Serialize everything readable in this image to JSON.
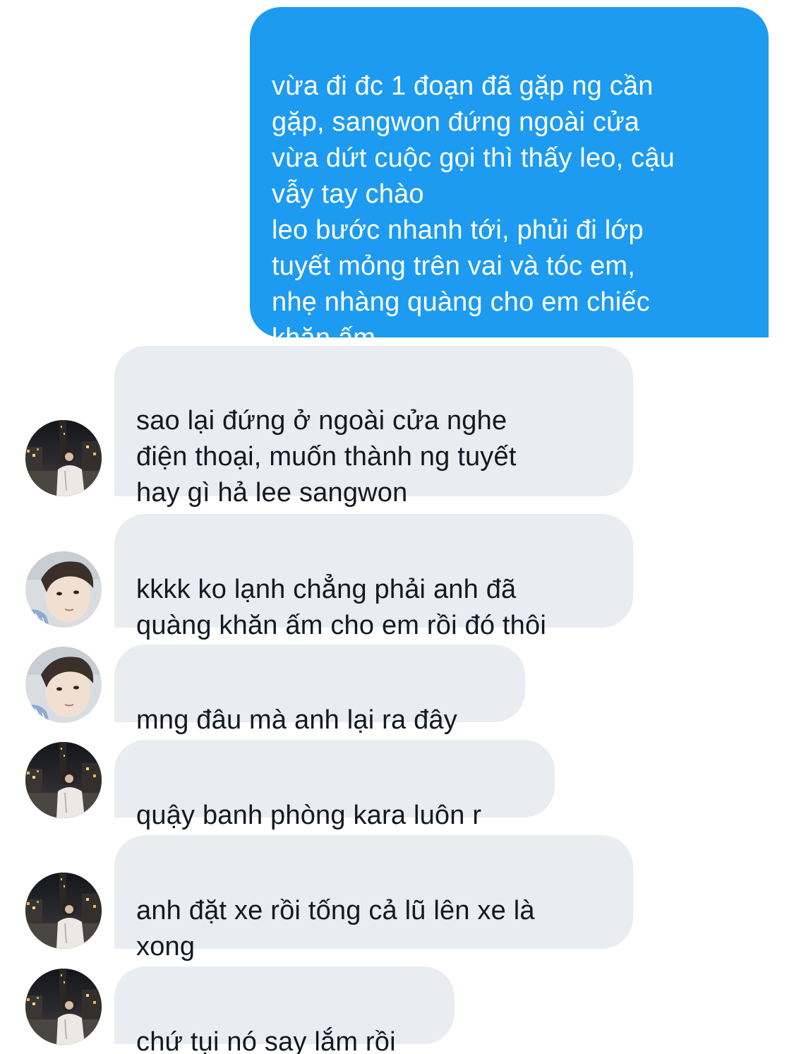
{
  "conversation": {
    "messages": [
      {
        "direction": "sent",
        "text": "vừa đi đc 1 đoạn đã gặp ng cần\ngặp, sangwon đứng ngoài cửa\nvừa dứt cuộc gọi thì thấy leo, cậu\nvẫy tay chào\nleo bước nhanh tới, phủi đi lớp\ntuyết mỏng trên vai và tóc em,\nnhẹ nhàng quàng cho em chiếc\nkhăn ấm"
      },
      {
        "direction": "received",
        "avatar": "avatar-night-street",
        "text": "sao lại đứng ở ngoài cửa nghe\nđiện thoại, muốn thành ng tuyết\nhay gì hả lee sangwon"
      },
      {
        "direction": "received",
        "avatar": "avatar-selfie",
        "text": "kkkk ko lạnh chẳng phải anh đã\nquàng khăn ấm cho em rồi đó thôi"
      },
      {
        "direction": "received",
        "avatar": "avatar-selfie",
        "text": "mng đâu mà anh lại ra đây"
      },
      {
        "direction": "received",
        "avatar": "avatar-night-street",
        "text": "quậy banh phòng kara luôn r"
      },
      {
        "direction": "received",
        "avatar": "avatar-night-street",
        "text": "anh đặt xe rồi tống cả lũ lên xe là\nxong"
      },
      {
        "direction": "received",
        "avatar": "avatar-night-street",
        "text": "chứ tụi nó say lắm rồi"
      }
    ]
  },
  "colors": {
    "sent_bubble": "#1d9bf0",
    "received_bubble": "#e9edf1",
    "received_text": "#141823",
    "sent_text": "#ffffff",
    "background": "#ffffff"
  }
}
